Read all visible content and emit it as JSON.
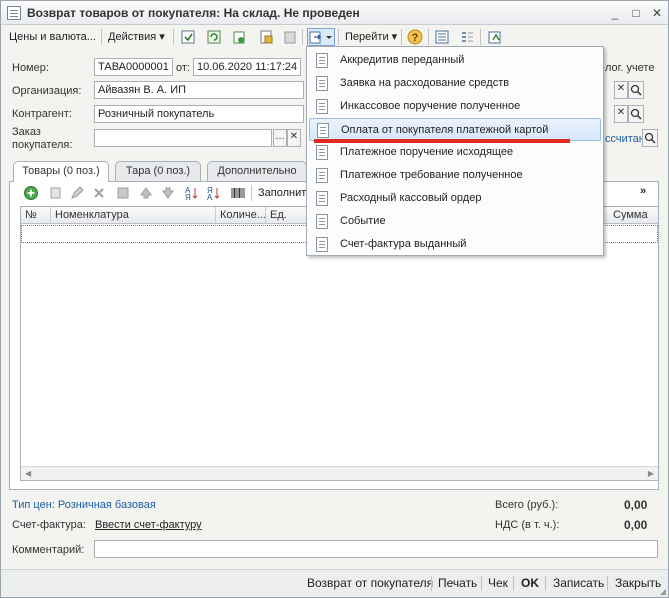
{
  "window": {
    "title": "Возврат товаров от покупателя: На склад. Не проведен",
    "controls": [
      "_",
      "□",
      "✕"
    ]
  },
  "toolbar": {
    "prices_label": "Цены и валюта...",
    "actions_label": "Действия",
    "goto_label": "Перейти",
    "help_glyph": "?"
  },
  "header": {
    "number_label": "Номер:",
    "number_value": "ТАВА0000001",
    "date_label": "от:",
    "date_value": "10.06.2020 11:17:24",
    "tax_text": "лог. учете",
    "org_label": "Организация:",
    "org_value": "Айвазян В. А. ИП",
    "contragent_label": "Контрагент:",
    "contragent_value": "Розничный покупатель",
    "order_label_1": "Заказ",
    "order_label_2": "покупателя:",
    "order_value": "",
    "recalc_text": "ссчитан"
  },
  "tabs": [
    {
      "label": "Товары (0 поз.)"
    },
    {
      "label": "Тара (0 поз.)"
    },
    {
      "label": "Дополнительно"
    }
  ],
  "grid_toolbar": {
    "fill_label": "Заполнит"
  },
  "grid": {
    "columns": [
      "№",
      "Номенклатура",
      "Количе...",
      "Ед.",
      "Сумма"
    ]
  },
  "menu": {
    "items": [
      "Аккредитив переданный",
      "Заявка на расходование средств",
      "Инкассовое поручение полученное",
      "Оплата от покупателя платежной картой",
      "Платежное поручение исходящее",
      "Платежное требование полученное",
      "Расходный кассовый ордер",
      "Событие",
      "Счет-фактура выданный"
    ],
    "highlighted_index": 3
  },
  "footer": {
    "price_type": "Тип цен: Розничная базовая",
    "invoice_label": "Счет-фактура:",
    "invoice_link": "Ввести счет-фактуру",
    "total_label": "Всего (руб.):",
    "total_value": "0,00",
    "vat_label": "НДС (в т. ч.):",
    "vat_value": "0,00",
    "comment_label": "Комментарий:",
    "comment_value": ""
  },
  "bottombar": {
    "return_label": "Возврат от покупателя",
    "print_label": "Печать",
    "receipt_label": "Чек",
    "ok_label": "OK",
    "save_label": "Записать",
    "close_label": "Закрыть"
  },
  "colors": {
    "highlight_bg": "#d6e7fb",
    "annotation_red": "#e0291f",
    "link_blue": "#1f5fa8"
  }
}
